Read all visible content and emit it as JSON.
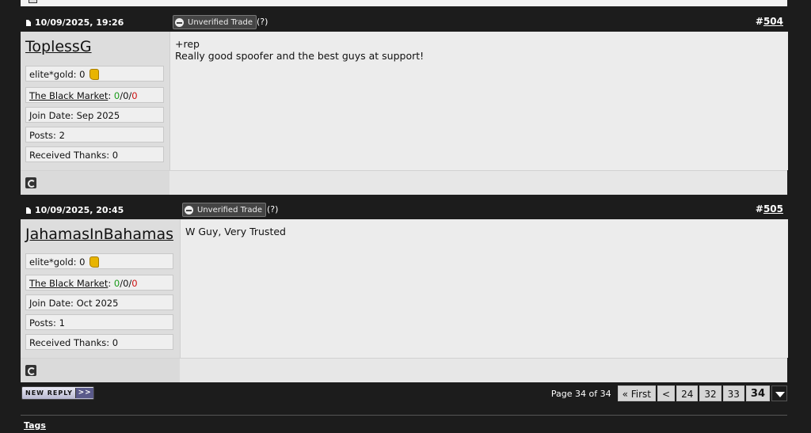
{
  "posts": [
    {
      "date": "10/09/2025, 19:26",
      "badge": "Unverified Trade",
      "help": "(?)",
      "post_hash": "#",
      "post_number": "504",
      "username": "ToplessG",
      "gold_label": "elite*gold: 0",
      "market_label": "The Black Market",
      "market_pos": "0",
      "market_neu": "0",
      "market_neg": "0",
      "join_date": "Join Date: Sep 2025",
      "posts": "Posts: 2",
      "thanks": "Received Thanks: 0",
      "message": "+rep\nReally good spoofer and the best guys at support!"
    },
    {
      "date": "10/09/2025, 20:45",
      "badge": "Unverified Trade",
      "help": "(?)",
      "post_hash": "#",
      "post_number": "505",
      "username": "JahamasInBahamas",
      "gold_label": "elite*gold: 0",
      "market_label": "The Black Market",
      "market_pos": "0",
      "market_neu": "0",
      "market_neg": "0",
      "join_date": "Join Date: Oct 2025",
      "posts": "Posts: 1",
      "thanks": "Received Thanks: 0",
      "message": "W Guy, Very Trusted"
    }
  ],
  "new_reply": {
    "label": "NEW REPLY",
    "arrows": ">>"
  },
  "pagination": {
    "info": "Page 34 of 34",
    "first": "« First",
    "prev": "<",
    "pages": [
      "24",
      "32",
      "33"
    ],
    "current": "34"
  },
  "tags": {
    "label": "Tags"
  },
  "colors": {
    "accent_dark": "#1c1c1c",
    "positive": "#1a9a1a",
    "negative": "#cc1111"
  }
}
